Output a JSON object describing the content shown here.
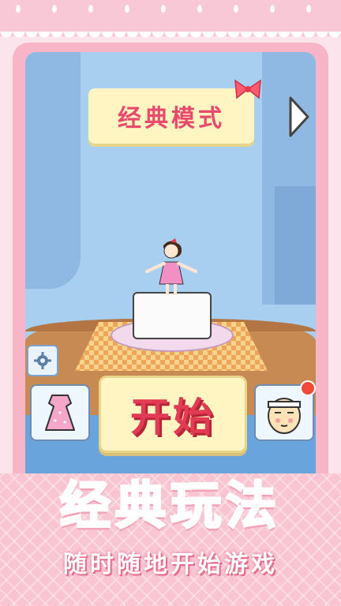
{
  "mode": {
    "title": "经典模式"
  },
  "buttons": {
    "start_label": "开始"
  },
  "promo": {
    "title": "经典玩法",
    "subtitle": "随时随地开始游戏"
  },
  "colors": {
    "accent": "#e84a6c",
    "frame": "#f8b5c8",
    "scene_bg": "#a8cff0",
    "banner": "#fff5c2"
  },
  "icons": [
    "bow-icon",
    "next-arrow-icon",
    "settings-gear-icon",
    "dress-icon",
    "character-face-icon",
    "notification-dot"
  ]
}
